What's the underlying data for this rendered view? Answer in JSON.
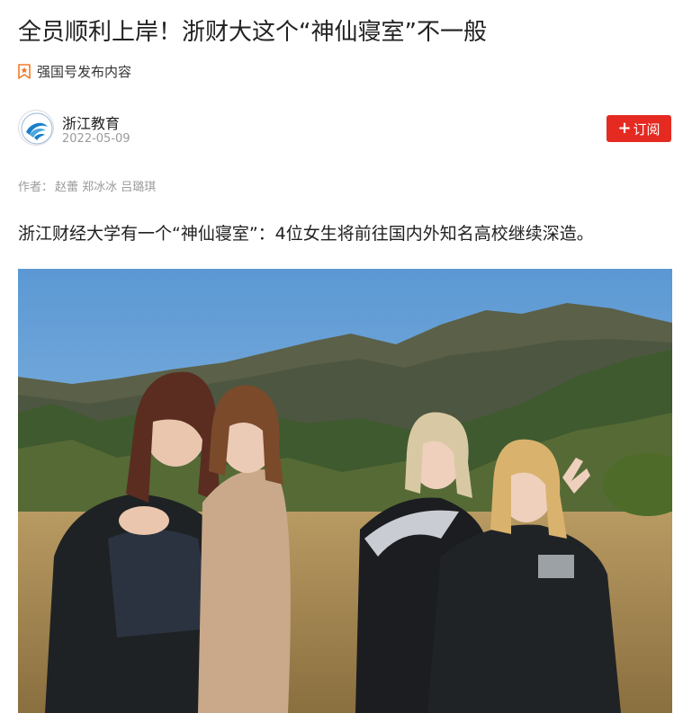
{
  "article": {
    "title": "全员顺利上岸！浙财大这个“神仙寝室”不一般",
    "source_label": "强国号发布内容",
    "account": {
      "name": "浙江教育",
      "date": "2022-05-09"
    },
    "subscribe": {
      "plus": "+",
      "label": "订阅"
    },
    "authors": {
      "prefix": "作者：",
      "names": "赵蕾 郑冰冰 吕璐琪"
    },
    "lead": "浙江财经大学有一个“神仙寝室”：4位女生将前往国内外知名高校继续深造。"
  },
  "colors": {
    "accent_red": "#e52a22",
    "source_icon": "#f07b2a",
    "muted_text": "#9a9a9a"
  },
  "icons": {
    "source": "bookmark-star-icon",
    "avatar": "zhejiang-education-logo-icon"
  }
}
